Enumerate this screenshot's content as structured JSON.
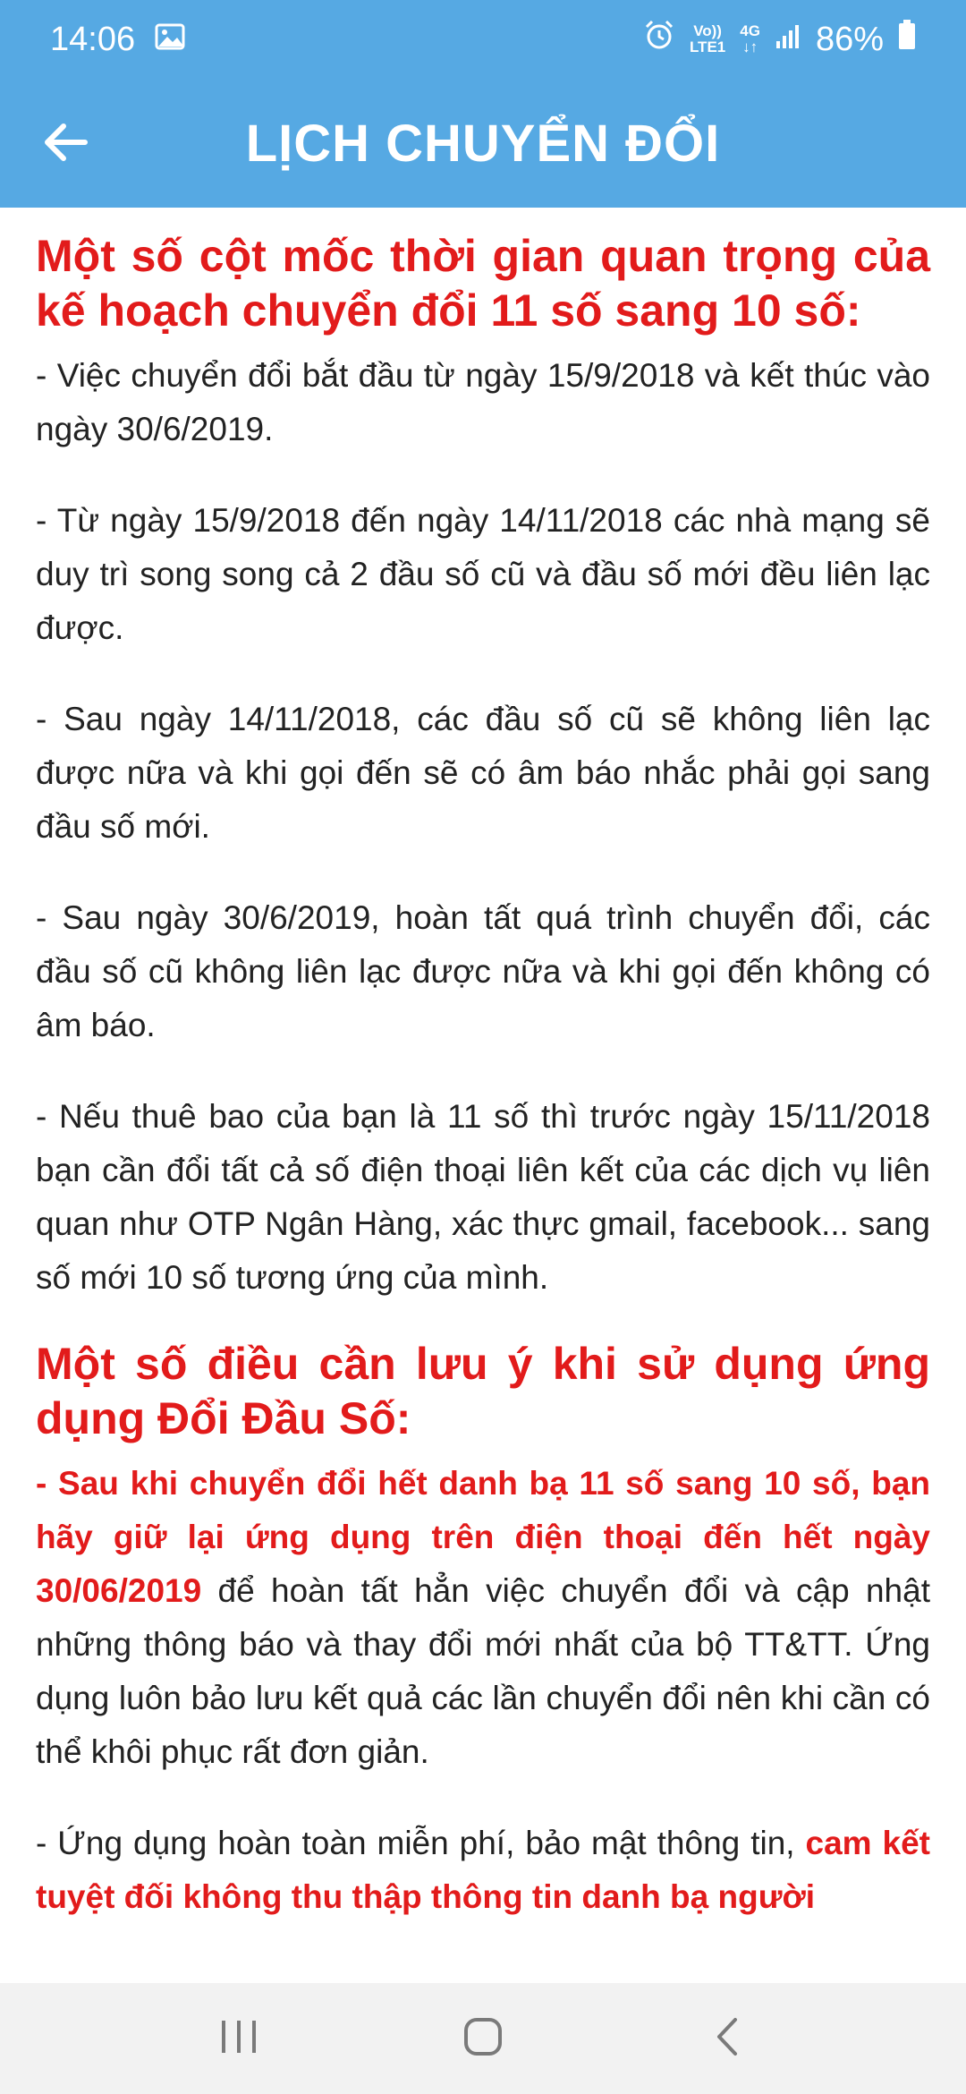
{
  "status_bar": {
    "time": "14:06",
    "volte_top": "Vo))",
    "volte_bottom": "LTE1",
    "network": "4G",
    "battery": "86%"
  },
  "app_bar": {
    "title": "LỊCH CHUYỂN ĐỔI"
  },
  "content": {
    "heading1": "Một số cột mốc thời gian quan trọng của kế hoạch chuyển đổi 11 số sang 10 số:",
    "p1": "- Việc chuyển đổi bắt đầu từ ngày 15/9/2018 và kết thúc vào ngày 30/6/2019.",
    "p2": "- Từ ngày 15/9/2018 đến ngày 14/11/2018 các nhà mạng sẽ duy trì song song cả 2 đầu số cũ và đầu số mới đều liên lạc được.",
    "p3": "- Sau ngày 14/11/2018, các đầu số cũ sẽ không liên lạc được nữa và khi gọi đến sẽ có âm báo nhắc phải gọi sang đầu số mới.",
    "p4": "- Sau ngày 30/6/2019, hoàn tất quá trình chuyển đổi, các đầu số cũ không liên lạc được nữa và khi gọi đến không có âm báo.",
    "p5": "- Nếu thuê bao của bạn là 11 số thì trước ngày 15/11/2018 bạn cần đổi tất cả số điện thoại liên kết của các dịch vụ liên quan như OTP Ngân Hàng, xác thực gmail, facebook... sang số mới 10 số tương ứng của mình.",
    "heading2": "Một số điều cần lưu ý khi sử dụng ứng dụng Đổi Đầu Số:",
    "p6_dash": "- ",
    "p6_red": "Sau khi chuyển đổi hết danh bạ 11 số sang 10 số, bạn hãy giữ lại ứng dụng trên điện thoại đến hết ngày 30/06/2019",
    "p6_rest": " để hoàn tất hẳn việc chuyển đổi và cập nhật những thông báo và thay đổi mới nhất của bộ TT&TT. Ứng dụng luôn bảo lưu kết quả các lần chuyển đổi nên khi cần có thể khôi phục rất đơn giản.",
    "p7_start": "- Ứng dụng hoàn toàn miễn phí, bảo mật thông tin, ",
    "p7_red": "cam kết tuyệt đối không thu thập thông tin danh bạ người"
  }
}
